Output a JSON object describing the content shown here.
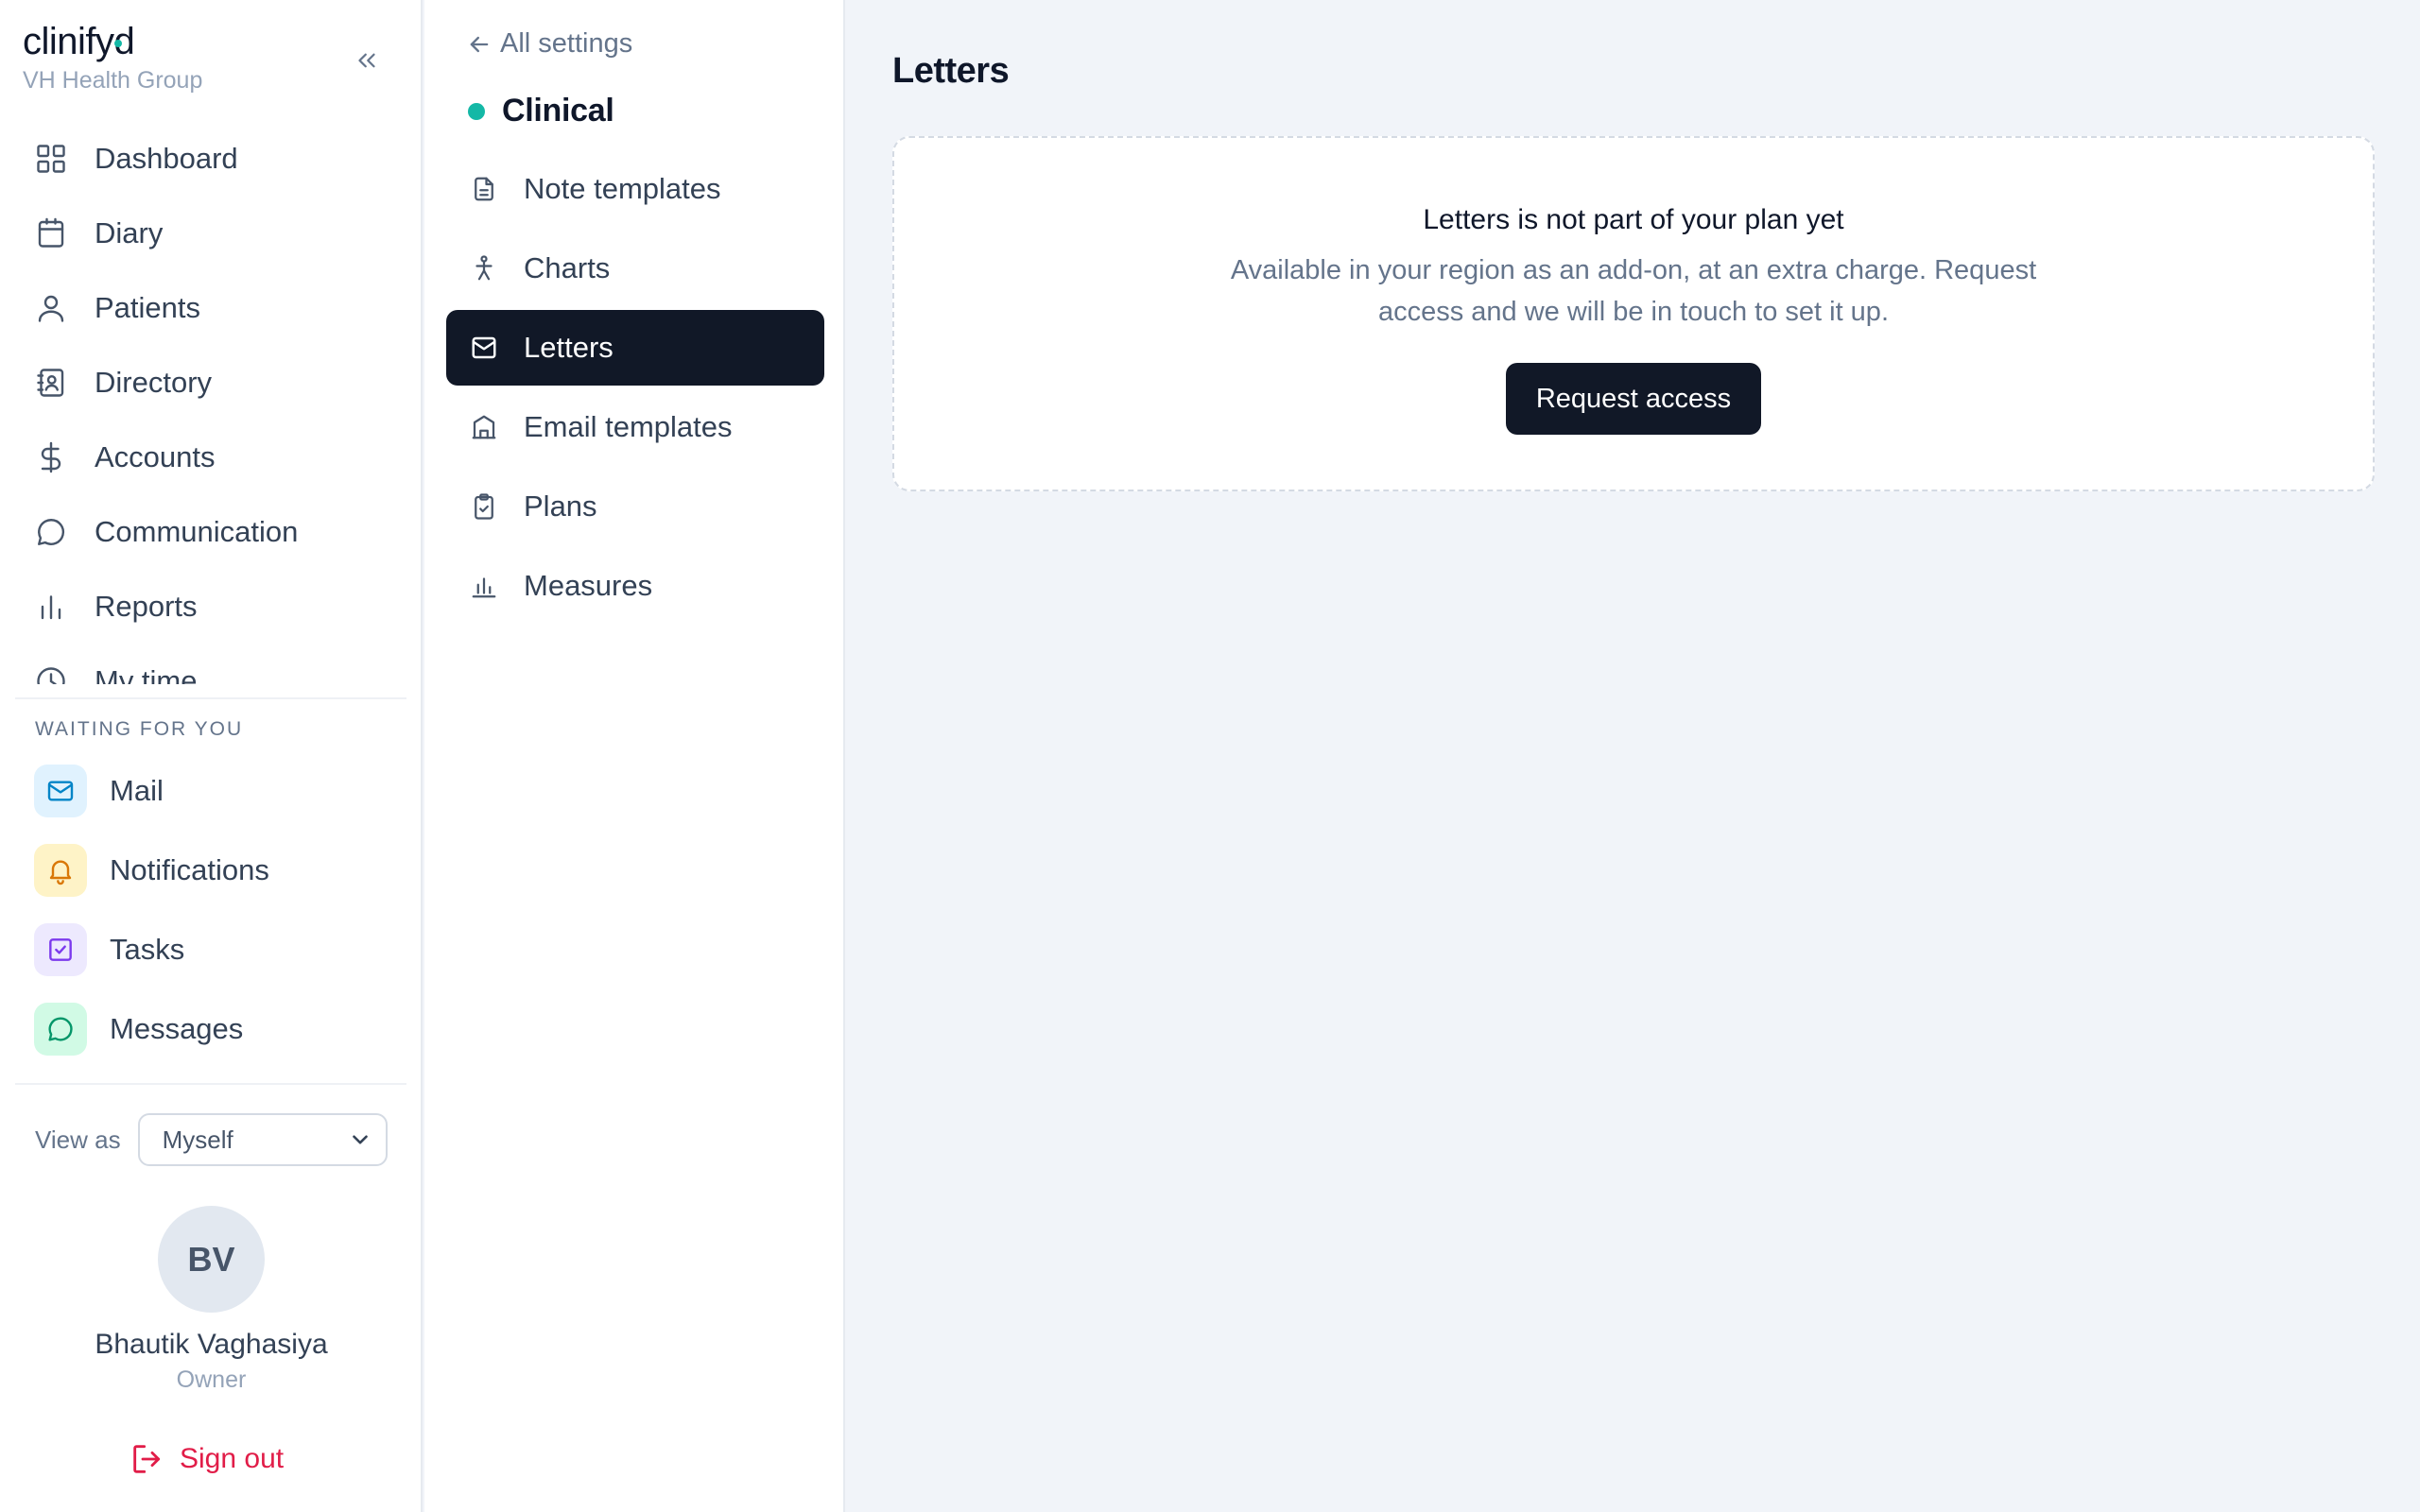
{
  "brand": {
    "logo_text": "clinifyd",
    "org_name": "VH Health Group"
  },
  "sidebar": {
    "nav": [
      {
        "label": "Dashboard",
        "icon": "grid-icon"
      },
      {
        "label": "Diary",
        "icon": "calendar-icon"
      },
      {
        "label": "Patients",
        "icon": "user-icon"
      },
      {
        "label": "Directory",
        "icon": "contact-book-icon"
      },
      {
        "label": "Accounts",
        "icon": "dollar-icon"
      },
      {
        "label": "Communication",
        "icon": "chat-bubble-icon"
      },
      {
        "label": "Reports",
        "icon": "bar-chart-icon"
      },
      {
        "label": "My time",
        "icon": "clock-icon"
      }
    ],
    "waiting_title": "WAITING FOR YOU",
    "waiting": [
      {
        "label": "Mail",
        "icon": "mail-icon",
        "color": "#0284c7",
        "bg": "#e0f2fe"
      },
      {
        "label": "Notifications",
        "icon": "bell-icon",
        "color": "#d97706",
        "bg": "#fef3c7"
      },
      {
        "label": "Tasks",
        "icon": "check-square-icon",
        "color": "#7c3aed",
        "bg": "#ede9fe"
      },
      {
        "label": "Messages",
        "icon": "chat-bubble-icon",
        "color": "#059669",
        "bg": "#d1fae5"
      }
    ],
    "view_as_label": "View as",
    "view_as_value": "Myself",
    "user": {
      "initials": "BV",
      "name": "Bhautik Vaghasiya",
      "role": "Owner"
    },
    "sign_out": "Sign out"
  },
  "settings_nav": {
    "back_label": "All settings",
    "group_title": "Clinical",
    "items": [
      {
        "label": "Note templates",
        "icon": "document-icon",
        "active": false
      },
      {
        "label": "Charts",
        "icon": "person-figure-icon",
        "active": false
      },
      {
        "label": "Letters",
        "icon": "envelope-icon",
        "active": true
      },
      {
        "label": "Email templates",
        "icon": "building-icon",
        "active": false
      },
      {
        "label": "Plans",
        "icon": "clipboard-check-icon",
        "active": false
      },
      {
        "label": "Measures",
        "icon": "bar-chart-icon",
        "active": false
      }
    ]
  },
  "main": {
    "title": "Letters",
    "upsell": {
      "heading": "Letters is not part of your plan yet",
      "description": "Available in your region as an add-on, at an extra charge. Request access and we will be in touch to set it up.",
      "button_label": "Request access"
    }
  },
  "colors": {
    "accent": "#14b8a6",
    "dark": "#111827",
    "danger": "#e11d48"
  }
}
